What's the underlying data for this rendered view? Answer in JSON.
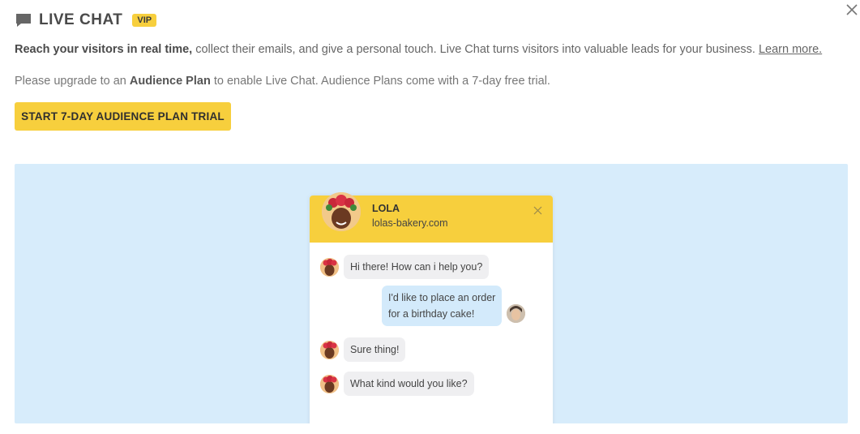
{
  "header": {
    "title": "LIVE CHAT",
    "badge": "VIP",
    "chat_icon": "chat-bubble-icon",
    "close_icon": "close-icon"
  },
  "intro": {
    "bold": "Reach your visitors in real time,",
    "text": " collect their emails, and give a personal touch. Live Chat turns visitors into valuable leads for your business. ",
    "link": "Learn more."
  },
  "upgrade": {
    "prefix": "Please upgrade to an ",
    "bold": "Audience Plan",
    "suffix": " to enable Live Chat. Audience Plans come with a 7-day free trial."
  },
  "cta": {
    "label": "START 7-DAY AUDIENCE PLAN TRIAL"
  },
  "preview": {
    "agent": {
      "name": "LOLA",
      "site": "lolas-bakery.com"
    },
    "messages": [
      {
        "from": "agent",
        "lines": [
          "Hi there! How can i help you?"
        ]
      },
      {
        "from": "user",
        "lines": [
          "I'd like to place an order",
          "for a birthday cake!"
        ]
      },
      {
        "from": "agent",
        "lines": [
          "Sure thing!"
        ]
      },
      {
        "from": "agent",
        "lines": [
          "What kind would you like?"
        ]
      }
    ]
  },
  "colors": {
    "accent": "#f7cf3d",
    "preview_bg": "#d7ecfb",
    "agent_bubble": "#efeff1",
    "user_bubble": "#d3eafb"
  }
}
